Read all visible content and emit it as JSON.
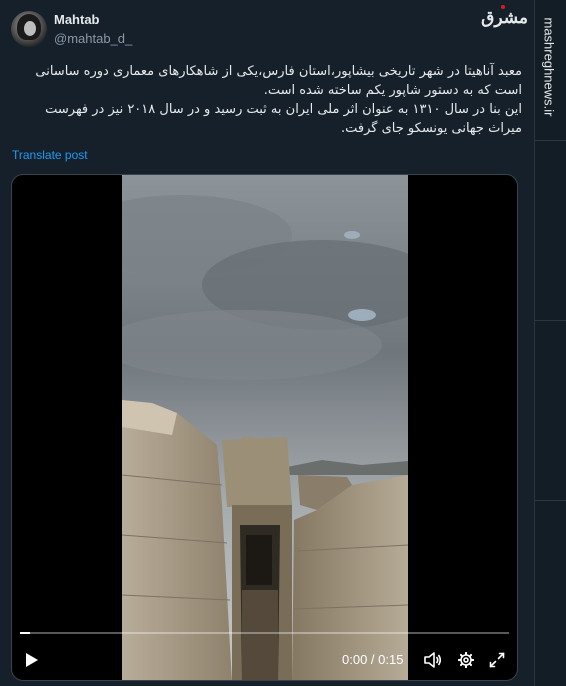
{
  "user": {
    "name": "Mahtab",
    "handle": "@mahtab_d_"
  },
  "tweet": {
    "paragraph1": "معبد آناهیتا در شهر تاریخی بیشاپور،استان فارس،یکی از شاهکارهای معماری دوره ساسانی است که به دستور شاپور یکم ساخته شده است.",
    "paragraph2": "این بنا در سال ۱۳۱۰ به عنوان اثر ملی ایران به ثبت رسید و در سال ۲۰۱۸ نیز در فهرست میراث جهانی یونسکو جای گرفت.",
    "translate_label": "Translate post"
  },
  "video": {
    "time": "0:00 / 0:15",
    "progress_fraction": 0.02
  },
  "branding": {
    "logo_text": "مشرق",
    "watermark": "mashreghnews.ir",
    "accent_color": "#1d9bf0",
    "logo_dot_color": "#d21f26"
  },
  "icons": {
    "play": "play-icon",
    "volume": "volume-icon",
    "settings": "gear-icon",
    "fullscreen": "fullscreen-icon"
  }
}
